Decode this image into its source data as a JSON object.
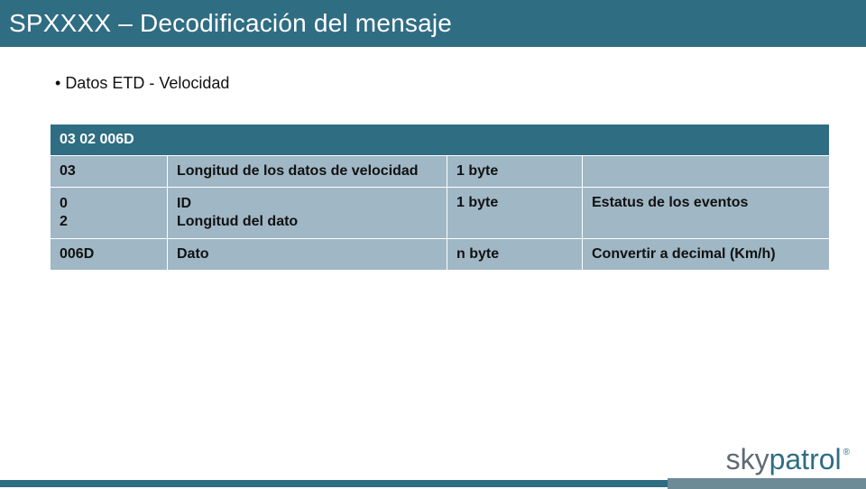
{
  "title": "SPXXXX – Decodificación del mensaje",
  "bullet": "Datos ETD - Velocidad",
  "table": {
    "header": "03 02 006D",
    "rows": [
      {
        "c1": "03",
        "c2": "Longitud de los datos de velocidad",
        "c3": "1 byte",
        "c4": ""
      },
      {
        "c1": "0\n2",
        "c2": "ID\nLongitud del dato",
        "c3": "1 byte",
        "c4": "Estatus de los eventos"
      },
      {
        "c1": "006D",
        "c2": "Dato",
        "c3": "n byte",
        "c4": "Convertir a decimal (Km/h)"
      }
    ]
  },
  "logo": {
    "part1": "sky",
    "part2": "patrol",
    "reg": "®"
  }
}
